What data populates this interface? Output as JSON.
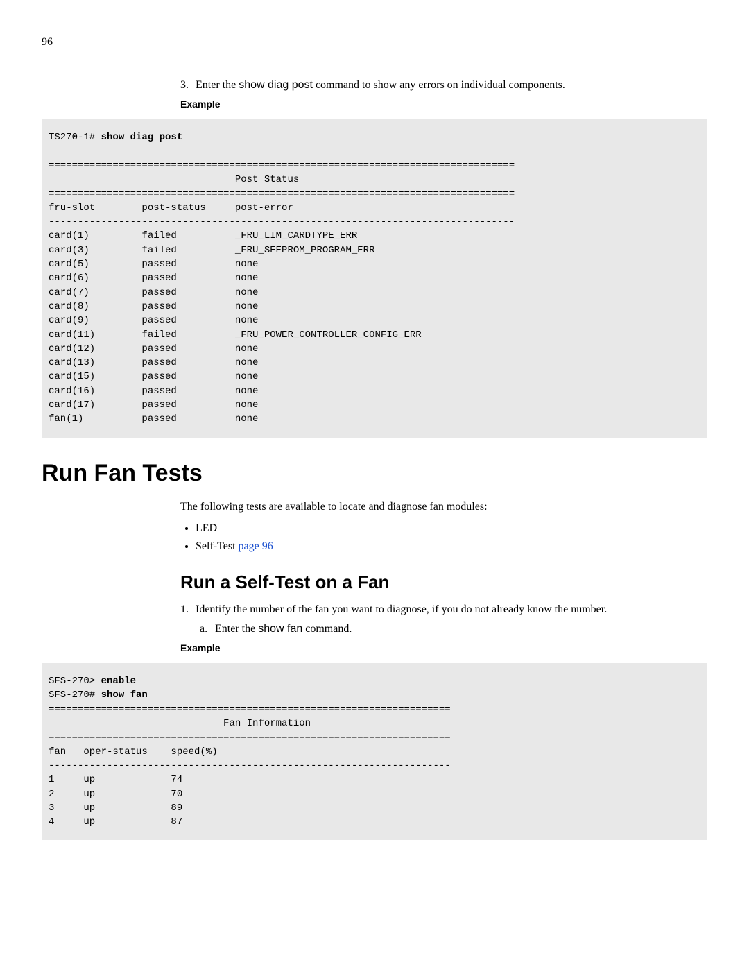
{
  "page_number": "96",
  "step3": {
    "num": "3.",
    "pre": "Enter the ",
    "cmd": "show diag post",
    "post": " command to show any errors on individual components."
  },
  "example_label": "Example",
  "code1": {
    "prompt": "TS270-1# ",
    "command": "show diag post",
    "body": "\n\n================================================================================\n                                Post Status\n================================================================================\nfru-slot        post-status     post-error\n--------------------------------------------------------------------------------\ncard(1)         failed          _FRU_LIM_CARDTYPE_ERR\ncard(3)         failed          _FRU_SEEPROM_PROGRAM_ERR\ncard(5)         passed          none\ncard(6)         passed          none\ncard(7)         passed          none\ncard(8)         passed          none\ncard(9)         passed          none\ncard(11)        failed          _FRU_POWER_CONTROLLER_CONFIG_ERR\ncard(12)        passed          none\ncard(13)        passed          none\ncard(15)        passed          none\ncard(16)        passed          none\ncard(17)        passed          none\nfan(1)          passed          none"
  },
  "h1": "Run Fan Tests",
  "intro": "The following tests are available to locate and diagnose fan modules:",
  "bullets": {
    "b1": "LED",
    "b2_pre": "Self-Test ",
    "b2_link": "page 96"
  },
  "h2": "Run a Self-Test on a Fan",
  "step1": {
    "num": "1.",
    "text": "Identify the number of the fan you want to diagnose, if you do not already know the number."
  },
  "substep_a": {
    "num": "a.",
    "pre": "Enter the ",
    "cmd": "show fan",
    "post": " command."
  },
  "code2": {
    "line1_prompt": "SFS-270> ",
    "line1_cmd": "enable",
    "line2_prompt": "SFS-270# ",
    "line2_cmd": "show fan",
    "body": "=====================================================================\n                              Fan Information\n=====================================================================\nfan   oper-status    speed(%)\n---------------------------------------------------------------------\n1     up             74\n2     up             70\n3     up             89\n4     up             87"
  },
  "chart_data": [
    {
      "type": "table",
      "title": "Post Status",
      "columns": [
        "fru-slot",
        "post-status",
        "post-error"
      ],
      "rows": [
        [
          "card(1)",
          "failed",
          "_FRU_LIM_CARDTYPE_ERR"
        ],
        [
          "card(3)",
          "failed",
          "_FRU_SEEPROM_PROGRAM_ERR"
        ],
        [
          "card(5)",
          "passed",
          "none"
        ],
        [
          "card(6)",
          "passed",
          "none"
        ],
        [
          "card(7)",
          "passed",
          "none"
        ],
        [
          "card(8)",
          "passed",
          "none"
        ],
        [
          "card(9)",
          "passed",
          "none"
        ],
        [
          "card(11)",
          "failed",
          "_FRU_POWER_CONTROLLER_CONFIG_ERR"
        ],
        [
          "card(12)",
          "passed",
          "none"
        ],
        [
          "card(13)",
          "passed",
          "none"
        ],
        [
          "card(15)",
          "passed",
          "none"
        ],
        [
          "card(16)",
          "passed",
          "none"
        ],
        [
          "card(17)",
          "passed",
          "none"
        ],
        [
          "fan(1)",
          "passed",
          "none"
        ]
      ]
    },
    {
      "type": "table",
      "title": "Fan Information",
      "columns": [
        "fan",
        "oper-status",
        "speed(%)"
      ],
      "rows": [
        [
          "1",
          "up",
          "74"
        ],
        [
          "2",
          "up",
          "70"
        ],
        [
          "3",
          "up",
          "89"
        ],
        [
          "4",
          "up",
          "87"
        ]
      ]
    }
  ]
}
